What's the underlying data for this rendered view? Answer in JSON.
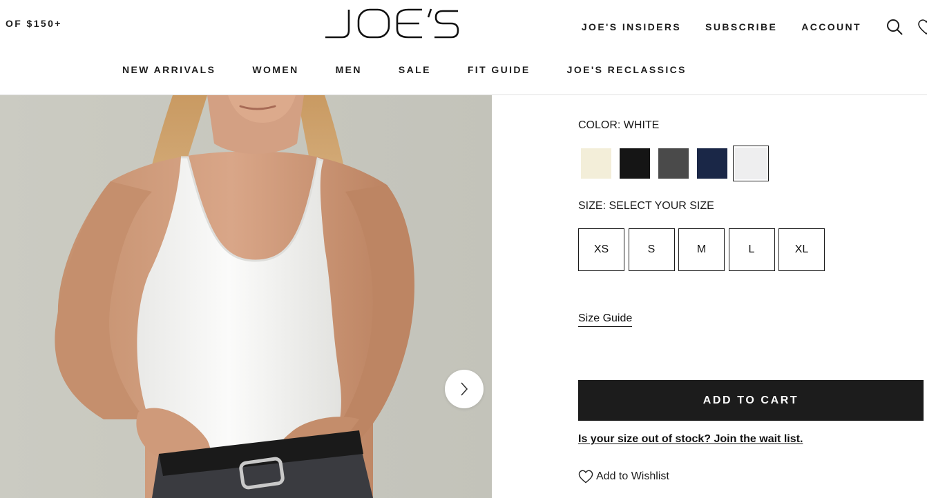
{
  "header": {
    "promo_text": "OF $150+",
    "logo_text": "JOE'S",
    "util_links": [
      "JOE'S INSIDERS",
      "SUBSCRIBE",
      "ACCOUNT"
    ],
    "icons": [
      "search-icon",
      "wishlist-heart-icon"
    ]
  },
  "nav": {
    "items": [
      "NEW ARRIVALS",
      "WOMEN",
      "MEN",
      "SALE",
      "FIT GUIDE",
      "JOE'S RECLASSICS"
    ]
  },
  "gallery": {
    "image": "model-in-white-tank-top",
    "next_icon": "chevron-right-icon"
  },
  "product": {
    "color_key": "COLOR:",
    "color_value": "WHITE",
    "swatches": [
      {
        "color": "#f3eed9",
        "name": "cream"
      },
      {
        "color": "#151515",
        "name": "black"
      },
      {
        "color": "#4a4a4a",
        "name": "charcoal"
      },
      {
        "color": "#1a2747",
        "name": "navy"
      },
      {
        "color": "#eeeeef",
        "name": "white",
        "selected": true
      }
    ],
    "size_key": "SIZE:",
    "size_value": "SELECT YOUR SIZE",
    "sizes": [
      "XS",
      "S",
      "M",
      "L",
      "XL"
    ],
    "size_guide": "Size Guide",
    "add_to_cart": "ADD TO CART",
    "waitlist": "Is your size out of stock? Join the wait list.",
    "wishlist": "Add to Wishlist",
    "wishlist_icon": "heart-outline-icon"
  },
  "colors": {
    "text": "#1c1c1c",
    "button_bg": "#1c1c1c",
    "button_text": "#ffffff",
    "rule": "#e1e1e1"
  }
}
